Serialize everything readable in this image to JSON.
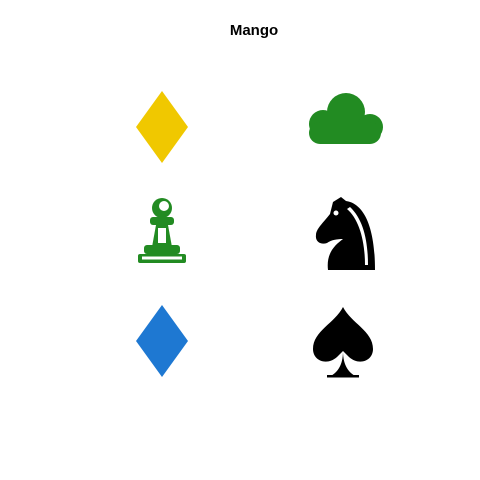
{
  "title": "Mango",
  "tiles": [
    {
      "icon": "diamond-icon",
      "color": "#f0c800"
    },
    {
      "icon": "cloud-icon",
      "color": "#228b22"
    },
    {
      "icon": "chess-pawn-icon",
      "color": "#228b22"
    },
    {
      "icon": "chess-knight-icon",
      "color": "#000000"
    },
    {
      "icon": "diamond-icon",
      "color": "#1e78d2"
    },
    {
      "icon": "spade-icon",
      "color": "#000000"
    }
  ]
}
